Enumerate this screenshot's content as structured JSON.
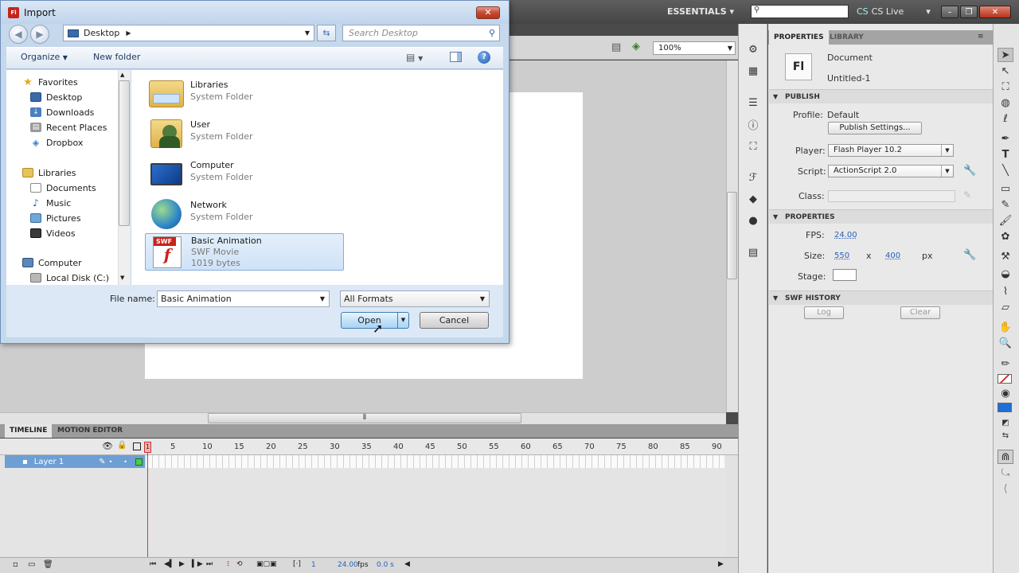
{
  "app": {
    "workspace": "ESSENTIALS",
    "search_placeholder": "",
    "cs_live": "CS Live",
    "zoom": "100%"
  },
  "timeline": {
    "tabs": [
      "TIMELINE",
      "MOTION EDITOR"
    ],
    "layer_name": "Layer 1",
    "ticks": [
      "1",
      "5",
      "10",
      "15",
      "20",
      "25",
      "30",
      "35",
      "40",
      "45",
      "50",
      "55",
      "60",
      "65",
      "70",
      "75",
      "80",
      "85",
      "90"
    ],
    "current_frame": "1",
    "fps": "24.00",
    "fps_unit": "fps",
    "time": "0.0 s"
  },
  "panel": {
    "tabs": [
      "PROPERTIES",
      "LIBRARY"
    ],
    "doc_icon": "Fl",
    "doc_type": "Document",
    "doc_name": "Untitled-1",
    "publish": {
      "header": "PUBLISH",
      "profile_label": "Profile:",
      "profile_value": "Default",
      "settings_button": "Publish Settings...",
      "player_label": "Player:",
      "player_value": "Flash Player 10.2",
      "script_label": "Script:",
      "script_value": "ActionScript 2.0",
      "class_label": "Class:"
    },
    "properties": {
      "header": "PROPERTIES",
      "fps_label": "FPS:",
      "fps_value": "24.00",
      "size_label": "Size:",
      "width": "550",
      "x": "x",
      "height": "400",
      "unit": "px",
      "stage_label": "Stage:",
      "stage_color": "#ffffff"
    },
    "history": {
      "header": "SWF HISTORY",
      "log_button": "Log",
      "clear_button": "Clear"
    }
  },
  "dialog": {
    "title": "Import",
    "title_icon": "Fl",
    "close": "✕",
    "address": "Desktop",
    "search_placeholder": "Search Desktop",
    "organize": "Organize",
    "new_folder": "New folder",
    "nav": {
      "favorites": "Favorites",
      "desktop": "Desktop",
      "downloads": "Downloads",
      "recent": "Recent Places",
      "dropbox": "Dropbox",
      "libraries": "Libraries",
      "documents": "Documents",
      "music": "Music",
      "pictures": "Pictures",
      "videos": "Videos",
      "computer": "Computer",
      "local_disk": "Local Disk (C:)"
    },
    "files": [
      {
        "name": "Libraries",
        "type": "System Folder"
      },
      {
        "name": "User",
        "type": "System Folder"
      },
      {
        "name": "Computer",
        "type": "System Folder"
      },
      {
        "name": "Network",
        "type": "System Folder"
      },
      {
        "name": "Basic Animation",
        "type": "SWF Movie",
        "size": "1019 bytes",
        "badge": "SWF"
      }
    ],
    "filename_label": "File name:",
    "filename_value": "Basic Animation",
    "filter_value": "All Formats",
    "open_button": "Open",
    "cancel_button": "Cancel"
  }
}
